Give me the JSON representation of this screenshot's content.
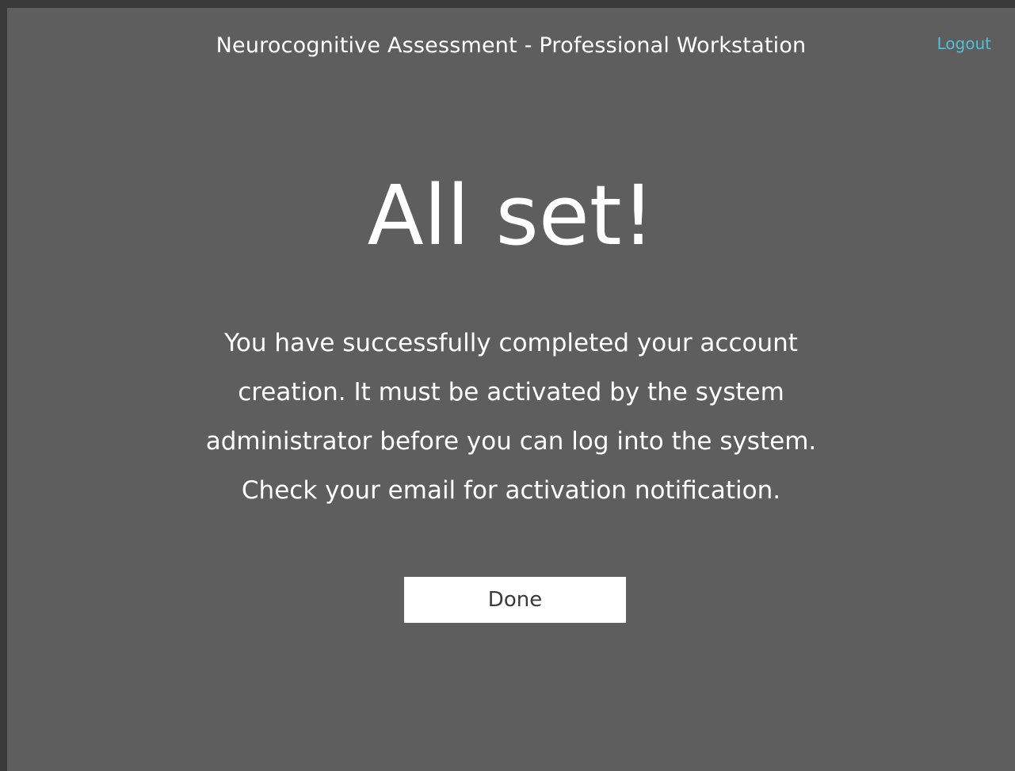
{
  "header": {
    "title": "Neurocognitive Assessment - Professional Workstation",
    "logout_label": "Logout"
  },
  "main": {
    "headline": "All set!",
    "message_lines": [
      "You have successfully completed your account",
      "creation. It must be activated by the system",
      "administrator before you can log into the system.",
      "Check your email for activation notification."
    ],
    "done_label": "Done"
  },
  "colors": {
    "background": "#5e5e5e",
    "link": "#53c0d6",
    "text": "#ffffff",
    "button_bg": "#ffffff",
    "button_text": "#3a3a3a"
  }
}
